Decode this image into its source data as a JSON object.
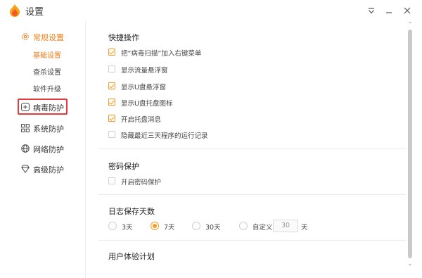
{
  "window": {
    "title": "设置"
  },
  "sidebar": {
    "items": [
      {
        "label": "常规设置",
        "icon": "gear-icon",
        "active": true
      },
      {
        "label": "病毒防护",
        "icon": "plus-square-icon",
        "highlighted": true
      },
      {
        "label": "系统防护",
        "icon": "grid-icon"
      },
      {
        "label": "网络防护",
        "icon": "globe-icon"
      },
      {
        "label": "高级防护",
        "icon": "diamond-icon"
      }
    ],
    "subitems": [
      {
        "label": "基础设置",
        "active": true
      },
      {
        "label": "查杀设置"
      },
      {
        "label": "软件升级"
      }
    ]
  },
  "sections": {
    "quick": {
      "title": "快捷操作",
      "options": [
        {
          "label": "把“病毒扫描”加入右键菜单",
          "checked": true
        },
        {
          "label": "显示流量悬浮窗",
          "checked": false
        },
        {
          "label": "显示U盘悬浮窗",
          "checked": true
        },
        {
          "label": "显示U盘托盘图标",
          "checked": true
        },
        {
          "label": "开启托盘消息",
          "checked": true
        },
        {
          "label": "隐藏最近三天程序的运行记录",
          "checked": false
        }
      ]
    },
    "password": {
      "title": "密码保护",
      "option": {
        "label": "开启密码保护",
        "checked": false
      }
    },
    "log": {
      "title": "日志保存天数",
      "options": [
        {
          "label": "3天",
          "checked": false
        },
        {
          "label": "7天",
          "checked": true
        },
        {
          "label": "30天",
          "checked": false
        },
        {
          "label": "自定义",
          "checked": false
        }
      ],
      "custom_value": "30",
      "unit": "天"
    },
    "experience": {
      "title": "用户体验计划"
    }
  },
  "colors": {
    "accent": "#f59a23",
    "active_text": "#ef7f1a",
    "highlight_border": "#e23b3b"
  }
}
